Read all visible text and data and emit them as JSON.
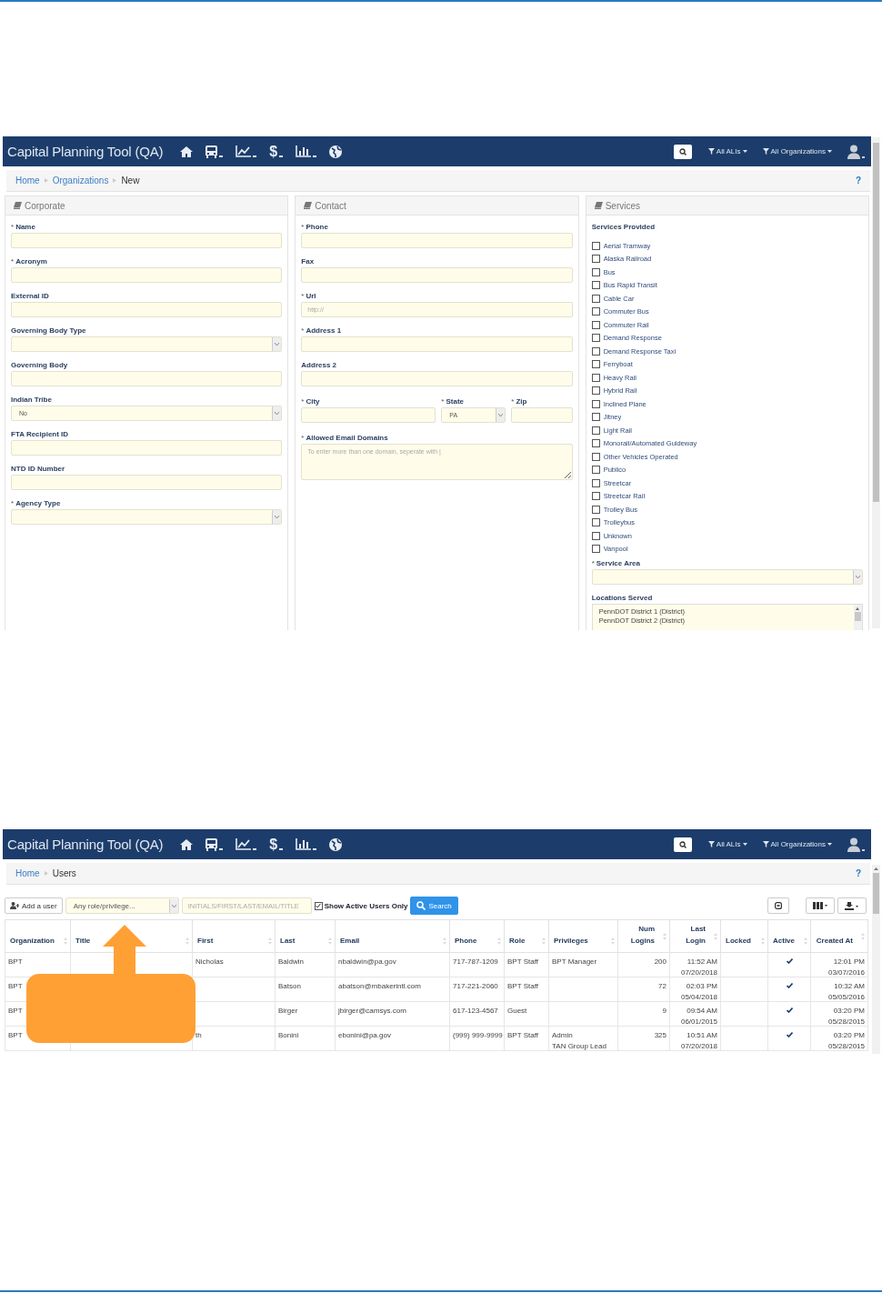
{
  "screens": [
    {
      "kind": "form",
      "navbar": {
        "title": "Capital Planning Tool (QA)",
        "menus": [
          {
            "kind": "home",
            "dropdown": false
          },
          {
            "kind": "bus",
            "dropdown": true
          },
          {
            "kind": "chart",
            "dropdown": true
          },
          {
            "kind": "dollar",
            "glyph": "$",
            "dropdown": true
          },
          {
            "kind": "bars",
            "dropdown": true
          },
          {
            "kind": "globe",
            "dropdown": false
          }
        ],
        "filters": [
          "All ALIs",
          "All Organizations"
        ]
      },
      "breadcrumb": [
        {
          "label": "Home",
          "link": true
        },
        {
          "label": "Organizations",
          "link": true
        },
        {
          "label": "New",
          "link": false
        }
      ],
      "help": "?",
      "panels": [
        {
          "title": "Corporate",
          "fields": [
            {
              "label": "Name",
              "required_mark": "*",
              "kind": "text"
            },
            {
              "label": "Acronym",
              "required_mark": "*",
              "kind": "text"
            },
            {
              "label": "External ID",
              "kind": "text"
            },
            {
              "label": "Governing Body Type",
              "kind": "select"
            },
            {
              "label": "Governing Body",
              "kind": "text"
            },
            {
              "label": "Indian Tribe",
              "kind": "select",
              "value": "No"
            },
            {
              "label": "FTA Recipient ID",
              "kind": "text"
            },
            {
              "label": "NTD ID Number",
              "kind": "text"
            },
            {
              "label": "Agency Type",
              "required_mark": "*",
              "kind": "select"
            }
          ]
        },
        {
          "title": "Contact",
          "fields": [
            {
              "label": "Phone",
              "required_mark": "*",
              "kind": "text"
            },
            {
              "label": "Fax",
              "kind": "text"
            },
            {
              "label": "Url",
              "required_mark": "*",
              "kind": "text",
              "placeholder": "http://"
            },
            {
              "label": "Address 1",
              "required_mark": "*",
              "kind": "text"
            },
            {
              "label": "Address 2",
              "kind": "text"
            },
            {
              "kind": "group",
              "fields": [
                {
                  "label": "City",
                  "required_mark": "*",
                  "kind": "text"
                },
                {
                  "label": "State",
                  "required_mark": "*",
                  "kind": "select",
                  "value": "PA"
                },
                {
                  "label": "Zip",
                  "required_mark": "*",
                  "kind": "text"
                }
              ]
            },
            {
              "label": "Allowed Email Domains",
              "required_mark": "*",
              "kind": "textarea",
              "placeholder": "To enter more than one domain, seperate with |"
            }
          ]
        },
        {
          "title": "Services",
          "services_label": "Services Provided",
          "services": [
            {
              "label": "Aerial Tramway",
              "checked": false
            },
            {
              "label": "Alaska Railroad",
              "checked": false
            },
            {
              "label": "Bus",
              "checked": false
            },
            {
              "label": "Bus Rapid Transit",
              "checked": false
            },
            {
              "label": "Cable Car",
              "checked": false
            },
            {
              "label": "Commuter Bus",
              "checked": false
            },
            {
              "label": "Commuter Rail",
              "checked": false
            },
            {
              "label": "Demand Response",
              "checked": false
            },
            {
              "label": "Demand Response Taxi",
              "checked": false
            },
            {
              "label": "Ferryboat",
              "checked": false
            },
            {
              "label": "Heavy Rail",
              "checked": false
            },
            {
              "label": "Hybrid Rail",
              "checked": false
            },
            {
              "label": "Inclined Plane",
              "checked": false
            },
            {
              "label": "Jitney",
              "checked": false
            },
            {
              "label": "Light Rail",
              "checked": false
            },
            {
              "label": "Monorail/Automated Guideway",
              "checked": false
            },
            {
              "label": "Other Vehicles Operated",
              "checked": false
            },
            {
              "label": "Publico",
              "checked": false
            },
            {
              "label": "Streetcar",
              "checked": false
            },
            {
              "label": "Streetcar Rail",
              "checked": false
            },
            {
              "label": "Trolley Bus",
              "checked": false
            },
            {
              "label": "Trolleybus",
              "checked": false
            },
            {
              "label": "Unknown",
              "checked": false
            },
            {
              "label": "Vanpool",
              "checked": false
            }
          ],
          "fields": [
            {
              "label": "Service Area",
              "required_mark": "*",
              "kind": "select"
            }
          ],
          "locations_label": "Locations Served",
          "locations": [
            "PennDOT District 1 (District)",
            "PennDOT District 2 (District)"
          ]
        }
      ]
    },
    {
      "kind": "users",
      "navbar": {
        "title": "Capital Planning Tool (QA)",
        "menus": [
          {
            "kind": "home",
            "dropdown": false
          },
          {
            "kind": "bus",
            "dropdown": true
          },
          {
            "kind": "chart",
            "dropdown": true
          },
          {
            "kind": "dollar",
            "glyph": "$",
            "dropdown": true
          },
          {
            "kind": "bars",
            "dropdown": true
          },
          {
            "kind": "globe",
            "dropdown": false
          }
        ],
        "filters": [
          "All ALIs",
          "All Organizations"
        ]
      },
      "breadcrumb": [
        {
          "label": "Home",
          "link": true
        },
        {
          "label": "Users",
          "link": false
        }
      ],
      "help": "?",
      "toolbar": {
        "add_button": "Add a user",
        "role_select": "Any role/privilege...",
        "search_placeholder": "INITIALS/FIRST/LAST/EMAIL/TITLE",
        "active_only": {
          "label": "Show Active Users Only",
          "checked": true
        },
        "search_button": "Search"
      },
      "columns": [
        "Organization",
        "Title",
        "First",
        "Last",
        "Email",
        "Phone",
        "Role",
        "Privileges",
        "Num Logins",
        "Last Login",
        "Locked",
        "Active",
        "Created At"
      ],
      "rows": [
        {
          "organization": "BPT",
          "first": "Nicholas",
          "last": "Baldwin",
          "email": "nbaldwin@pa.gov",
          "phone": "717-787-1209",
          "role": "BPT Staff",
          "privileges": "BPT Manager",
          "num_logins": "200",
          "last_login": "11:52 AM\n07/20/2018",
          "active": true,
          "created_at": "12:01 PM\n03/07/2016"
        },
        {
          "organization": "BPT",
          "last": "Batson",
          "email": "abatson@mbakerintl.com",
          "phone": "717-221-2060",
          "role": "BPT Staff",
          "num_logins": "72",
          "last_login": "02:03 PM\n05/04/2018",
          "active": true,
          "created_at": "10:32 AM\n05/05/2016"
        },
        {
          "organization": "BPT",
          "last": "Birger",
          "email": "jbirger@camsys.com",
          "phone": "617-123-4567",
          "role": "Guest",
          "num_logins": "9",
          "last_login": "09:54 AM\n06/01/2015",
          "active": true,
          "created_at": "03:20 PM\n05/28/2015"
        },
        {
          "organization": "BPT",
          "first": "th",
          "last": "Bonini",
          "email": "ebonini@pa.gov",
          "phone": "(999) 999-9999",
          "role": "BPT Staff",
          "privileges": "Admin\nTAN Group Lead",
          "num_logins": "325",
          "last_login": "10:51 AM\n07/20/2018",
          "active": true,
          "created_at": "03:20 PM\n05/28/2015"
        }
      ],
      "callout": {
        "kind": "arrow_up"
      }
    }
  ]
}
